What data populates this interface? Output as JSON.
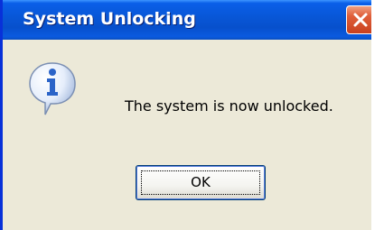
{
  "dialog": {
    "title": "System Unlocking",
    "message": "The system is now unlocked.",
    "ok_label": "OK",
    "icon": "info-icon",
    "close_icon": "close-icon"
  },
  "colors": {
    "titlebar": "#0856d6",
    "window_bg": "#ece9d8",
    "close_button": "#e0603b",
    "info_icon": "#2a63c8"
  }
}
